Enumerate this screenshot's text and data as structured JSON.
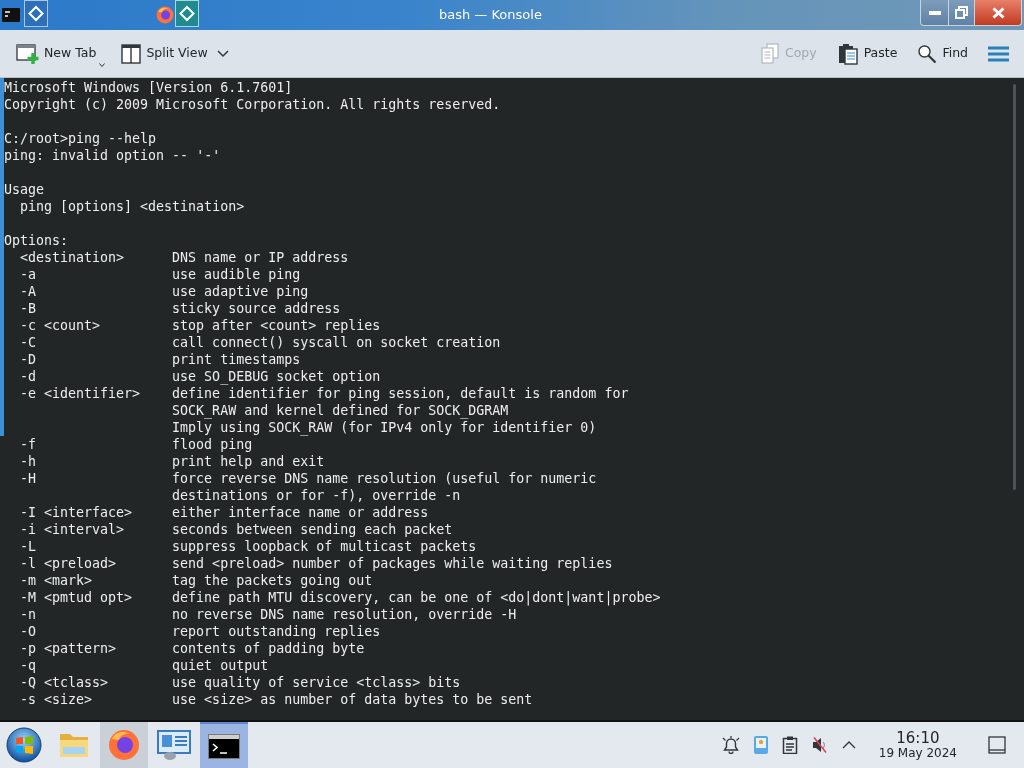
{
  "window": {
    "title": "bash — Konsole"
  },
  "toolbar": {
    "left": [
      {
        "kind": "new_tab",
        "label": "New Tab",
        "disabled": false
      },
      {
        "kind": "split_view",
        "label": "Split View",
        "disabled": false
      }
    ],
    "right": [
      {
        "kind": "copy",
        "label": "Copy",
        "disabled": true
      },
      {
        "kind": "paste",
        "label": "Paste",
        "disabled": false
      },
      {
        "kind": "find",
        "label": "Find",
        "disabled": false
      }
    ]
  },
  "terminal": {
    "blocks": [
      {
        "kind": "text",
        "lines": [
          "Microsoft Windows [Version 6.1.7601]",
          "Copyright (c) 2009 Microsoft Corporation. All rights reserved."
        ]
      },
      {
        "kind": "text",
        "lines": [
          "C:/root>ping --help",
          "ping: invalid option -- '-'"
        ]
      },
      {
        "kind": "section",
        "title": "Usage",
        "lines": [
          "ping [options] <destination>"
        ]
      },
      {
        "kind": "section",
        "title": "Options:",
        "options": [
          {
            "flag": "<destination>",
            "description": [
              "DNS name or IP address"
            ]
          },
          {
            "flag": "-a",
            "description": [
              "use audible ping"
            ]
          },
          {
            "flag": "-A",
            "description": [
              "use adaptive ping"
            ]
          },
          {
            "flag": "-B",
            "description": [
              "sticky source address"
            ]
          },
          {
            "flag": "-c <count>",
            "description": [
              "stop after <count> replies"
            ]
          },
          {
            "flag": "-C",
            "description": [
              "call connect() syscall on socket creation"
            ]
          },
          {
            "flag": "-D",
            "description": [
              "print timestamps"
            ]
          },
          {
            "flag": "-d",
            "description": [
              "use SO_DEBUG socket option"
            ]
          },
          {
            "flag": "-e <identifier>",
            "description": [
              "define identifier for ping session, default is random for",
              "SOCK_RAW and kernel defined for SOCK_DGRAM",
              "Imply using SOCK_RAW (for IPv4 only for identifier 0)"
            ]
          },
          {
            "flag": "-f",
            "description": [
              "flood ping"
            ]
          },
          {
            "flag": "-h",
            "description": [
              "print help and exit"
            ]
          },
          {
            "flag": "-H",
            "description": [
              "force reverse DNS name resolution (useful for numeric",
              "destinations or for -f), override -n"
            ]
          },
          {
            "flag": "-I <interface>",
            "description": [
              "either interface name or address"
            ]
          },
          {
            "flag": "-i <interval>",
            "description": [
              "seconds between sending each packet"
            ]
          },
          {
            "flag": "-L",
            "description": [
              "suppress loopback of multicast packets"
            ]
          },
          {
            "flag": "-l <preload>",
            "description": [
              "send <preload> number of packages while waiting replies"
            ]
          },
          {
            "flag": "-m <mark>",
            "description": [
              "tag the packets going out"
            ]
          },
          {
            "flag": "-M <pmtud opt>",
            "description": [
              "define path MTU discovery, can be one of <do|dont|want|probe>"
            ]
          },
          {
            "flag": "-n",
            "description": [
              "no reverse DNS name resolution, override -H"
            ]
          },
          {
            "flag": "-O",
            "description": [
              "report outstanding replies"
            ]
          },
          {
            "flag": "-p <pattern>",
            "description": [
              "contents of padding byte"
            ]
          },
          {
            "flag": "-q",
            "description": [
              "quiet output"
            ]
          },
          {
            "flag": "-Q <tclass>",
            "description": [
              "use quality of service <tclass> bits"
            ]
          },
          {
            "flag": "-s <size>",
            "description": [
              "use <size> as number of data bytes to be sent"
            ]
          }
        ]
      }
    ]
  },
  "taskbar": {
    "apps": [
      {
        "kind": "start",
        "hovered": false,
        "selected": false
      },
      {
        "kind": "files",
        "hovered": false,
        "selected": false
      },
      {
        "kind": "browser",
        "hovered": true,
        "selected": false
      },
      {
        "kind": "settings",
        "hovered": false,
        "selected": false
      },
      {
        "kind": "terminal",
        "hovered": false,
        "selected": true
      }
    ],
    "tray": {
      "volume": {
        "muted": true
      }
    },
    "clock": {
      "time": "16:10",
      "date": "19 May 2024"
    }
  }
}
